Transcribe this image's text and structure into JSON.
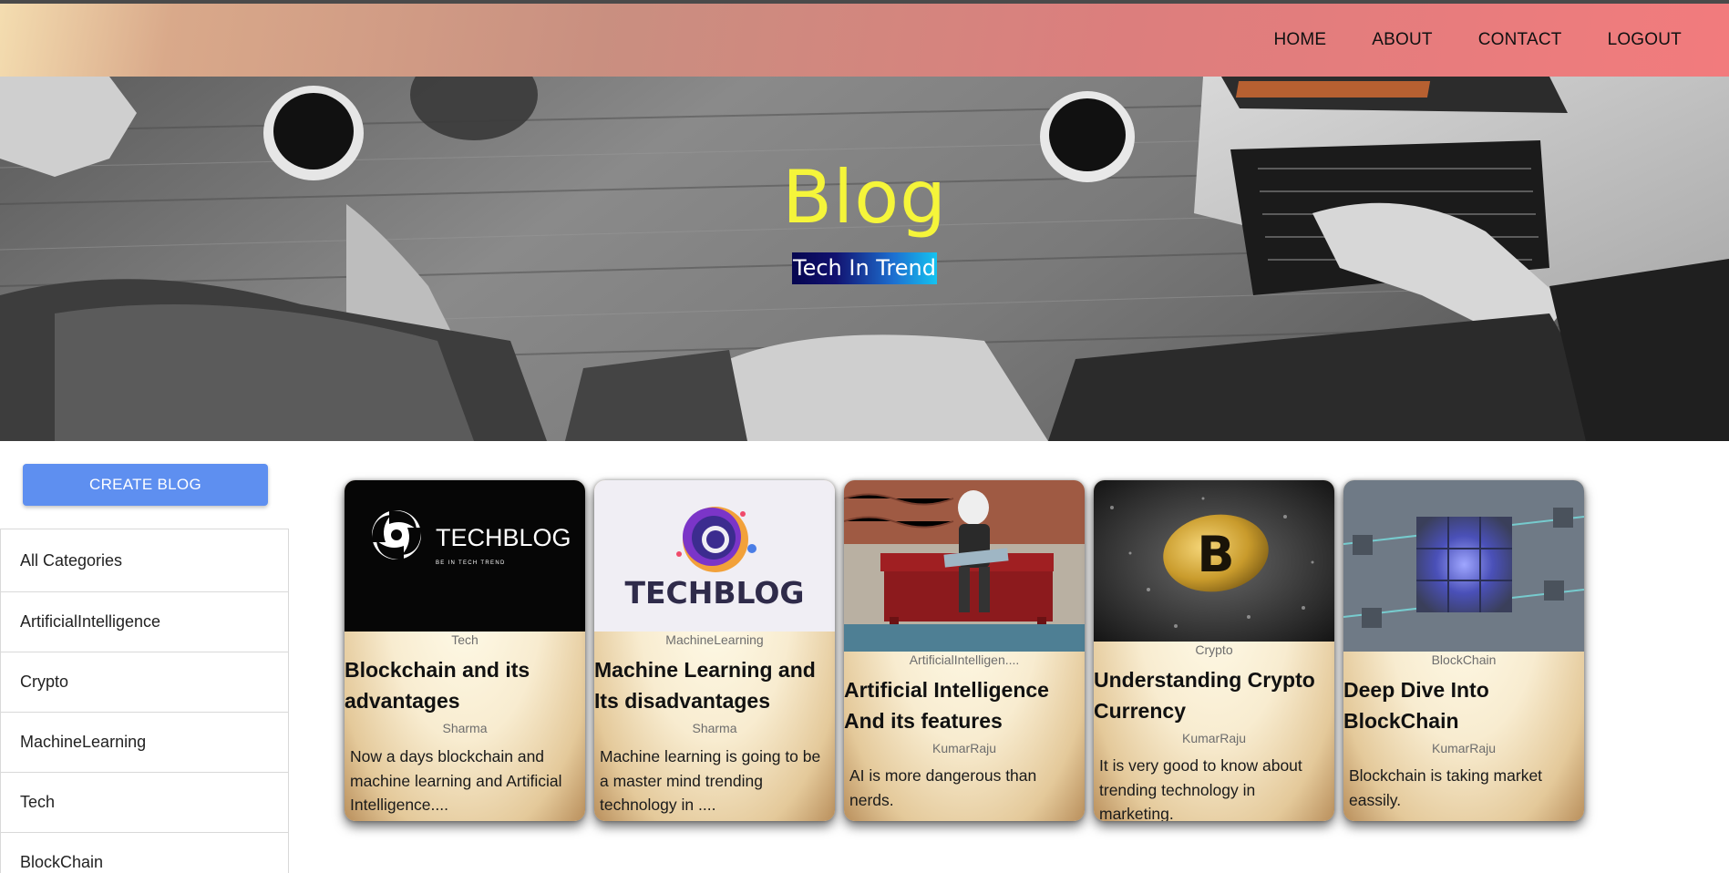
{
  "nav": {
    "links": [
      "HOME",
      "ABOUT",
      "CONTACT",
      "LOGOUT"
    ]
  },
  "hero": {
    "title": "Blog",
    "subtitle": "Tech In Trend"
  },
  "sidebar": {
    "create_button": "CREATE BLOG",
    "categories": [
      "All Categories",
      "ArtificialIntelligence",
      "Crypto",
      "MachineLearning",
      "Tech",
      "BlockChain"
    ]
  },
  "posts": [
    {
      "image": "techblog-logo-dark",
      "image_text": "TECHBLOG",
      "image_tagline": "BE IN TECH TREND",
      "category": "Tech",
      "title": "Blockchain and its advantages",
      "author": "Sharma",
      "excerpt": "Now a days blockchain and machine learning and Artificial Intelligence...."
    },
    {
      "image": "techblog-logo-light",
      "image_text": "TECHBLOG",
      "category": "MachineLearning",
      "title": "Machine Learning and Its disadvantages",
      "author": "Sharma",
      "excerpt": "Machine learning is going to be a master mind trending technology in ...."
    },
    {
      "image": "robot-reading-photo",
      "category": "ArtificialIntelligen....",
      "title": "Artificial Intelligence And its features",
      "author": "KumarRaju",
      "excerpt": "AI is more dangerous than nerds."
    },
    {
      "image": "bitcoin-coin-photo",
      "image_text": "B",
      "category": "Crypto",
      "title": "Understanding Crypto Currency",
      "author": "KumarRaju",
      "excerpt": "It is very good to know about trending technology in marketing."
    },
    {
      "image": "blockchain-cubes-render",
      "category": "BlockChain",
      "title": "Deep Dive Into BlockChain",
      "author": "KumarRaju",
      "excerpt": "Blockchain is taking market eassily."
    }
  ],
  "colors": {
    "hero_title": "#f5f53a",
    "create_button": "#5e8ff0",
    "nav_gradient_start": "#f4ddb0",
    "nav_gradient_end": "#f27b7d"
  }
}
